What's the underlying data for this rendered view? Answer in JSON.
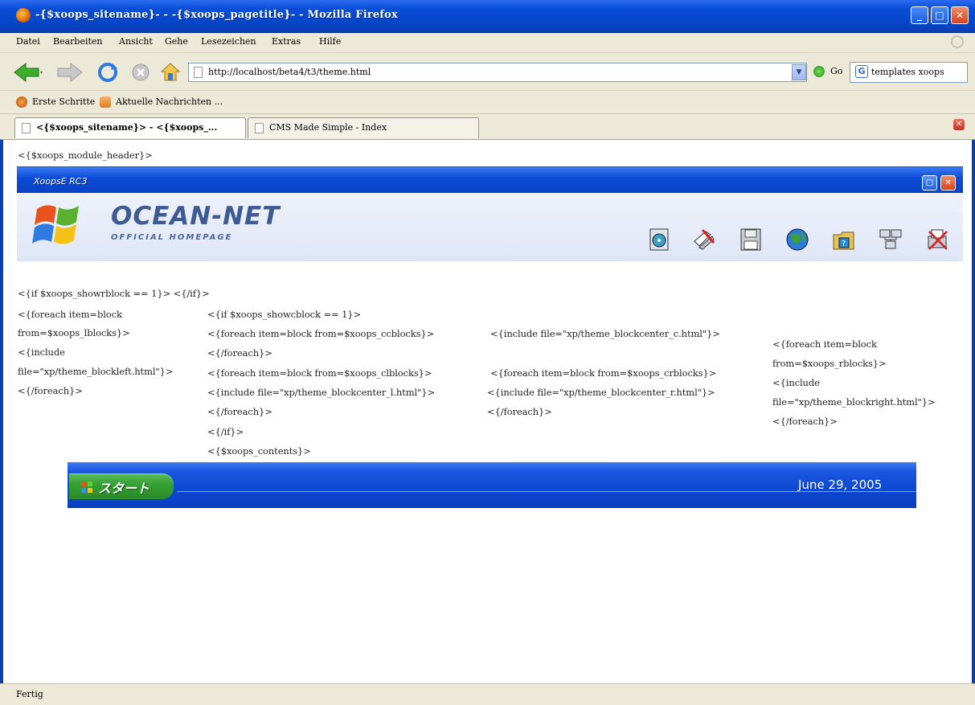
{
  "window": {
    "title": "-{$xoops_sitename}- - -{$xoops_pagetitle}- - Mozilla Firefox",
    "min_glyph": "_",
    "max_glyph": "□",
    "close_glyph": "✕"
  },
  "menu": [
    "Datei",
    "Bearbeiten",
    "Ansicht",
    "Gehe",
    "Lesezeichen",
    "Extras",
    "Hilfe"
  ],
  "navbar": {
    "url": "http://localhost/beta4/t3/theme.html",
    "go_label": "Go",
    "search_value": "templates xoops"
  },
  "bookmarks": [
    "Erste Schritte",
    "Aktuelle Nachrichten ..."
  ],
  "tabs": [
    {
      "label": "<{$xoops_sitename}> - <{$xoops_...",
      "active": true
    },
    {
      "label": "CMS Made Simple - Index",
      "active": false
    }
  ],
  "content": {
    "module_header": "<{$xoops_module_header}>",
    "left_col": {
      "line1": "<{if $xoops_showrblock == 1}> <{/if}>",
      "line2": "<{foreach item=block",
      "line3": "from=$xoops_lblocks}>",
      "line4": "<{include",
      "line5": "file=\"xp/theme_blockleft.html\"}>",
      "line6": "<{/foreach}>"
    },
    "center_col": {
      "line1": "<{if $xoops_showcblock == 1}>",
      "line2": "<{foreach item=block from=$xoops_ccblocks}>",
      "line3": "<{/foreach}>",
      "line4": "<{foreach item=block from=$xoops_clblocks}>",
      "line5": "<{include file=\"xp/theme_blockcenter_l.html\"}>",
      "line6": "<{/foreach}>",
      "line7": "<{/if}>",
      "line8": "<{$xoops_contents}>"
    },
    "center_right_col": {
      "line1": "<{include file=\"xp/theme_blockcenter_c.html\"}>",
      "line2": "<{foreach item=block from=$xoops_crblocks}>",
      "line3": "<{include file=\"xp/theme_blockcenter_r.html\"}>",
      "line4": "<{/foreach}>"
    },
    "right_col": {
      "line1": "<{foreach item=block",
      "line2": "from=$xoops_rblocks}>",
      "line3": "<{include",
      "line4": "file=\"xp/theme_blockright.html\"}>",
      "line5": "<{/foreach}>"
    }
  },
  "theme": {
    "window_title": "XoopsE RC3",
    "brand_title": "OCEAN-NET",
    "brand_subtitle": "OFFICIAL HOMEPAGE",
    "toolbar_icons": [
      "cd-icon",
      "tools-icon",
      "floppy-icon",
      "globe-icon",
      "folder-help-icon",
      "network-icon",
      "printer-icon"
    ]
  },
  "taskbar": {
    "start_label": "スタート",
    "clock": "June 29, 2005"
  },
  "status": "Fertig"
}
